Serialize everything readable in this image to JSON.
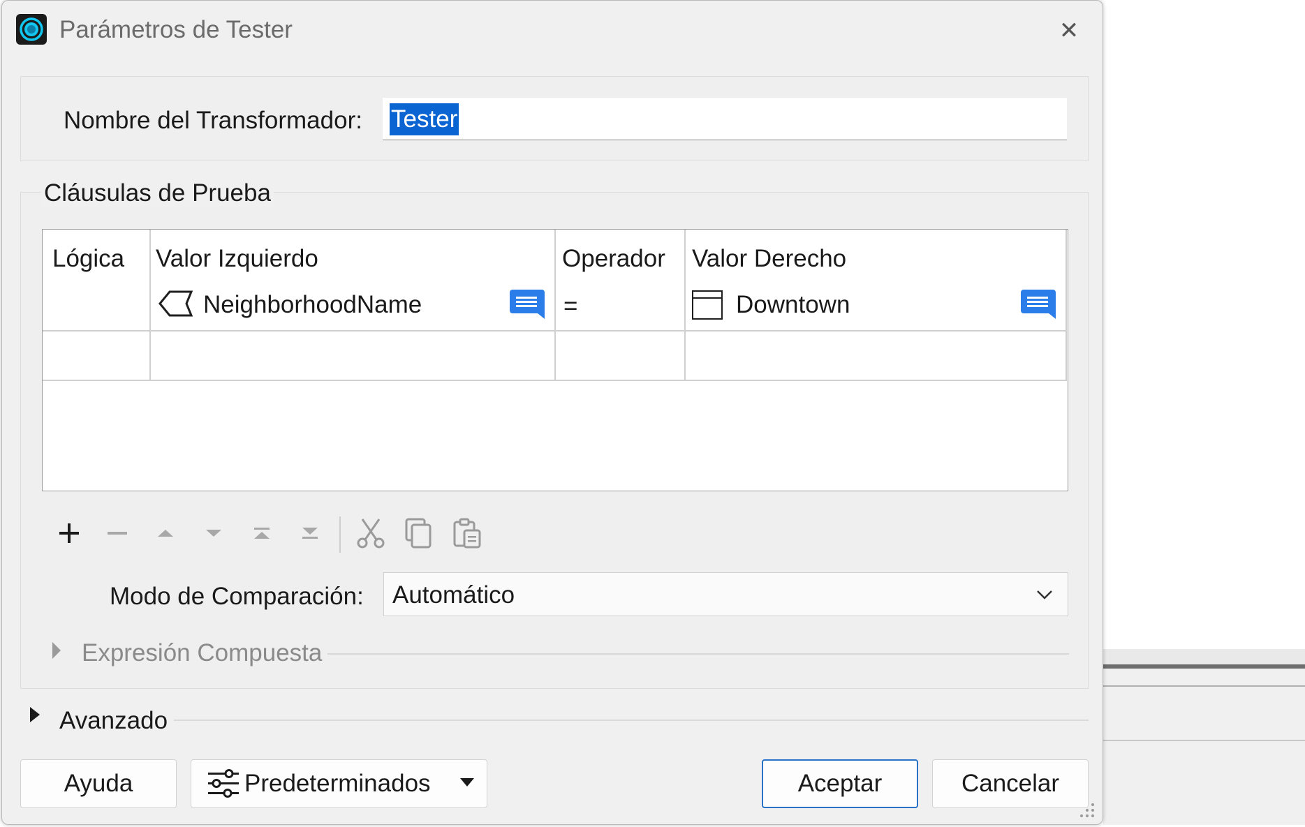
{
  "dialog": {
    "title": "Parámetros de Tester",
    "close_glyph": "✕"
  },
  "transformer": {
    "label": "Nombre del Transformador:",
    "value": "Tester"
  },
  "clauses": {
    "legend": "Cláusulas de Prueba",
    "columns": [
      "Lógica",
      "Valor Izquierdo",
      "Operador",
      "Valor Derecho"
    ],
    "rows": [
      {
        "logic": "",
        "left_value": "NeighborhoodName",
        "left_icon": "attribute-icon",
        "operator": "=",
        "right_value": "Downtown",
        "right_icon": "constant-value-icon"
      }
    ]
  },
  "toolbar": {
    "icons": [
      "add-icon",
      "remove-icon",
      "move-up-icon",
      "move-down-icon",
      "move-to-top-icon",
      "move-to-bottom-icon",
      "cut-icon",
      "copy-icon",
      "paste-icon"
    ]
  },
  "comparison": {
    "label": "Modo de Comparación:",
    "value": "Automático"
  },
  "compound": {
    "label": "Expresión Compuesta"
  },
  "advanced": {
    "label": "Avanzado"
  },
  "buttons": {
    "help": "Ayuda",
    "defaults": "Predeterminados",
    "ok": "Aceptar",
    "cancel": "Cancelar"
  },
  "colors": {
    "accent": "#2b7de9",
    "selection": "#0a64d2",
    "ok_border": "#2a71c8",
    "app_icon": "#12c6f0"
  }
}
